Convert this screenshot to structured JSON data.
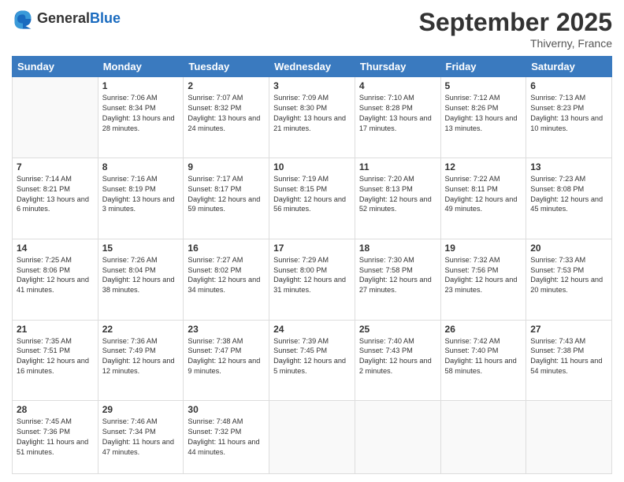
{
  "logo": {
    "line1": "General",
    "line2": "Blue"
  },
  "title": "September 2025",
  "subtitle": "Thiverny, France",
  "weekdays": [
    "Sunday",
    "Monday",
    "Tuesday",
    "Wednesday",
    "Thursday",
    "Friday",
    "Saturday"
  ],
  "weeks": [
    [
      null,
      {
        "day": 1,
        "sunrise": "7:06 AM",
        "sunset": "8:34 PM",
        "daylight": "13 hours and 28 minutes."
      },
      {
        "day": 2,
        "sunrise": "7:07 AM",
        "sunset": "8:32 PM",
        "daylight": "13 hours and 24 minutes."
      },
      {
        "day": 3,
        "sunrise": "7:09 AM",
        "sunset": "8:30 PM",
        "daylight": "13 hours and 21 minutes."
      },
      {
        "day": 4,
        "sunrise": "7:10 AM",
        "sunset": "8:28 PM",
        "daylight": "13 hours and 17 minutes."
      },
      {
        "day": 5,
        "sunrise": "7:12 AM",
        "sunset": "8:26 PM",
        "daylight": "13 hours and 13 minutes."
      },
      {
        "day": 6,
        "sunrise": "7:13 AM",
        "sunset": "8:23 PM",
        "daylight": "13 hours and 10 minutes."
      }
    ],
    [
      {
        "day": 7,
        "sunrise": "7:14 AM",
        "sunset": "8:21 PM",
        "daylight": "13 hours and 6 minutes."
      },
      {
        "day": 8,
        "sunrise": "7:16 AM",
        "sunset": "8:19 PM",
        "daylight": "13 hours and 3 minutes."
      },
      {
        "day": 9,
        "sunrise": "7:17 AM",
        "sunset": "8:17 PM",
        "daylight": "12 hours and 59 minutes."
      },
      {
        "day": 10,
        "sunrise": "7:19 AM",
        "sunset": "8:15 PM",
        "daylight": "12 hours and 56 minutes."
      },
      {
        "day": 11,
        "sunrise": "7:20 AM",
        "sunset": "8:13 PM",
        "daylight": "12 hours and 52 minutes."
      },
      {
        "day": 12,
        "sunrise": "7:22 AM",
        "sunset": "8:11 PM",
        "daylight": "12 hours and 49 minutes."
      },
      {
        "day": 13,
        "sunrise": "7:23 AM",
        "sunset": "8:08 PM",
        "daylight": "12 hours and 45 minutes."
      }
    ],
    [
      {
        "day": 14,
        "sunrise": "7:25 AM",
        "sunset": "8:06 PM",
        "daylight": "12 hours and 41 minutes."
      },
      {
        "day": 15,
        "sunrise": "7:26 AM",
        "sunset": "8:04 PM",
        "daylight": "12 hours and 38 minutes."
      },
      {
        "day": 16,
        "sunrise": "7:27 AM",
        "sunset": "8:02 PM",
        "daylight": "12 hours and 34 minutes."
      },
      {
        "day": 17,
        "sunrise": "7:29 AM",
        "sunset": "8:00 PM",
        "daylight": "12 hours and 31 minutes."
      },
      {
        "day": 18,
        "sunrise": "7:30 AM",
        "sunset": "7:58 PM",
        "daylight": "12 hours and 27 minutes."
      },
      {
        "day": 19,
        "sunrise": "7:32 AM",
        "sunset": "7:56 PM",
        "daylight": "12 hours and 23 minutes."
      },
      {
        "day": 20,
        "sunrise": "7:33 AM",
        "sunset": "7:53 PM",
        "daylight": "12 hours and 20 minutes."
      }
    ],
    [
      {
        "day": 21,
        "sunrise": "7:35 AM",
        "sunset": "7:51 PM",
        "daylight": "12 hours and 16 minutes."
      },
      {
        "day": 22,
        "sunrise": "7:36 AM",
        "sunset": "7:49 PM",
        "daylight": "12 hours and 12 minutes."
      },
      {
        "day": 23,
        "sunrise": "7:38 AM",
        "sunset": "7:47 PM",
        "daylight": "12 hours and 9 minutes."
      },
      {
        "day": 24,
        "sunrise": "7:39 AM",
        "sunset": "7:45 PM",
        "daylight": "12 hours and 5 minutes."
      },
      {
        "day": 25,
        "sunrise": "7:40 AM",
        "sunset": "7:43 PM",
        "daylight": "12 hours and 2 minutes."
      },
      {
        "day": 26,
        "sunrise": "7:42 AM",
        "sunset": "7:40 PM",
        "daylight": "11 hours and 58 minutes."
      },
      {
        "day": 27,
        "sunrise": "7:43 AM",
        "sunset": "7:38 PM",
        "daylight": "11 hours and 54 minutes."
      }
    ],
    [
      {
        "day": 28,
        "sunrise": "7:45 AM",
        "sunset": "7:36 PM",
        "daylight": "11 hours and 51 minutes."
      },
      {
        "day": 29,
        "sunrise": "7:46 AM",
        "sunset": "7:34 PM",
        "daylight": "11 hours and 47 minutes."
      },
      {
        "day": 30,
        "sunrise": "7:48 AM",
        "sunset": "7:32 PM",
        "daylight": "11 hours and 44 minutes."
      },
      null,
      null,
      null,
      null
    ]
  ]
}
